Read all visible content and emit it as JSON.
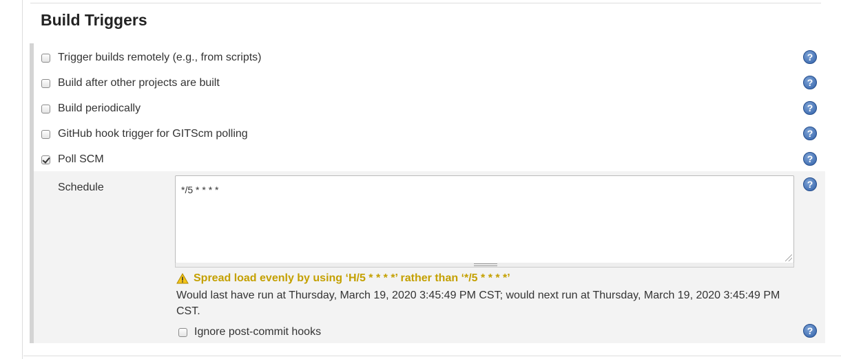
{
  "section": {
    "title": "Build Triggers"
  },
  "triggers": [
    {
      "label": "Trigger builds remotely (e.g., from scripts)",
      "checked": false
    },
    {
      "label": "Build after other projects are built",
      "checked": false
    },
    {
      "label": "Build periodically",
      "checked": false
    },
    {
      "label": "GitHub hook trigger for GITScm polling",
      "checked": false
    },
    {
      "label": "Poll SCM",
      "checked": true
    }
  ],
  "poll_scm": {
    "schedule_label": "Schedule",
    "schedule_value": "*/5 * * * *",
    "warning": "Spread load evenly by using ‘H/5 * * * *’ rather than ‘*/5 * * * *’",
    "info": "Would last have run at Thursday, March 19, 2020 3:45:49 PM CST; would next run at Thursday, March 19, 2020 3:45:49 PM CST.",
    "ignore_hooks_label": "Ignore post-commit hooks",
    "ignore_hooks_checked": false
  },
  "help_icon_glyph": "?",
  "colors": {
    "warning": "#c4a000",
    "help_icon": "#2f5fa8"
  }
}
